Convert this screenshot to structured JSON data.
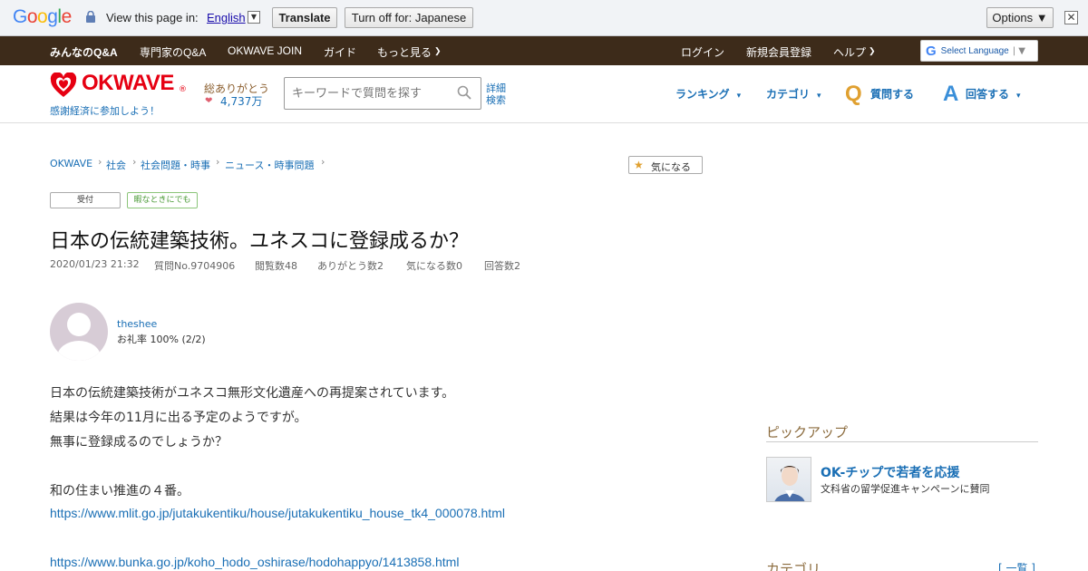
{
  "translate_bar": {
    "logo": "Google",
    "view_label": "View this page in:",
    "language": "English",
    "translate_btn": "Translate",
    "turnoff_btn": "Turn off for: Japanese",
    "options_btn": "Options ▼",
    "close": "✕"
  },
  "topnav": {
    "items": [
      "みんなのQ&A",
      "専門家のQ&A",
      "OKWAVE JOIN",
      "ガイド",
      "もっと見る"
    ],
    "right": [
      "ログイン",
      "新規会員登録",
      "ヘルプ"
    ],
    "select_language": "Select Language"
  },
  "header": {
    "logo": "OKWAVE",
    "logo_mark": "®",
    "tagline": "感謝経済に参加しよう！",
    "thanks_label": "総ありがとう",
    "thanks_count": "4,737万",
    "search_placeholder": "キーワードで質問を探す",
    "adv_search_1": "詳細",
    "adv_search_2": "検索",
    "nav": [
      "ランキング",
      "カテゴリ",
      "質問する",
      "回答する"
    ],
    "q_letter": "Q",
    "a_letter": "A"
  },
  "breadcrumb": [
    "OKWAVE",
    "社会",
    "社会問題・時事",
    "ニュース・時事問題"
  ],
  "kininaru": "気になる",
  "badges": [
    "受付",
    "暇なときにでも"
  ],
  "question": {
    "title": "日本の伝統建築技術。ユネスコに登録成るか？",
    "meta": [
      "2020/01/23 21:32",
      "質問No.9704906",
      "閲覧数48",
      "ありがとう数2",
      "気になる数0",
      "回答数2"
    ],
    "user": "theshee",
    "thanks_rate": "お礼率 100%  (2/2)",
    "body": [
      "日本の伝統建築技術がユネスコ無形文化遺産への再提案されています。",
      "結果は今年の11月に出る予定のようですが。",
      "無事に登録成るのでしょうか？",
      "和の住まい推進の４番。"
    ],
    "links": [
      "https://www.mlit.go.jp/jutakukentiku/house/jutakukentiku_house_tk4_000078.html",
      "https://www.bunka.go.jp/koho_hodo_oshirase/hodohappyo/1413858.html"
    ]
  },
  "sidebar": {
    "pickup_title": "ピックアップ",
    "pickup_headline": "OK-チップで若者を応援",
    "pickup_sub": "文科省の留学促進キャンペーンに賛同",
    "category_title": "カテゴリ",
    "category_all": "[ 一覧 ]"
  }
}
